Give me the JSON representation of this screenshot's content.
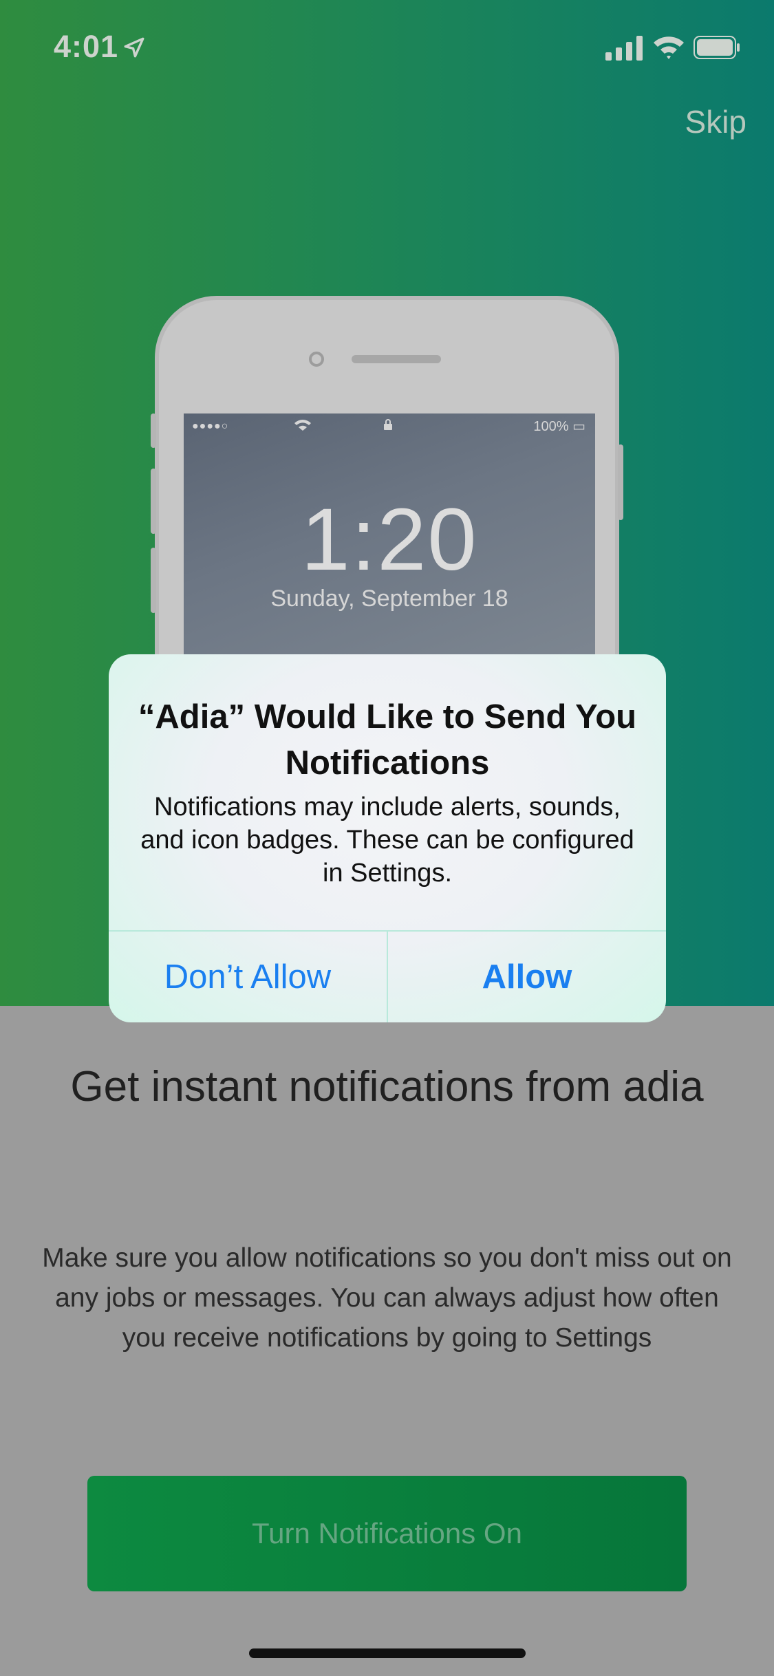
{
  "status_bar": {
    "time": "4:01",
    "icons": [
      "location-arrow-icon",
      "cellular-signal-icon",
      "wifi-icon",
      "battery-icon"
    ]
  },
  "header": {
    "skip_label": "Skip"
  },
  "illustration": {
    "status_battery": "100%",
    "clock": "1:20",
    "date": "Sunday, September 18"
  },
  "alert": {
    "title": "“Adia” Would Like to Send You Notifications",
    "message": "Notifications may include alerts, sounds, and icon badges. These can be configured in Settings.",
    "deny_label": "Don’t Allow",
    "allow_label": "Allow"
  },
  "main": {
    "headline": "Get instant notifications from adia",
    "body": "Make sure you allow notifications so you don't miss out on any jobs or messages. You can always adjust how often you receive notifications by going to Settings",
    "cta_label": "Turn Notifications On"
  },
  "colors": {
    "hero_gradient_start": "#2f8c3f",
    "hero_gradient_end": "#0b7a6d",
    "cta_green": "#0d8a40",
    "ios_blue": "#1a7ff0",
    "dim_background": "#9b9b9b"
  }
}
